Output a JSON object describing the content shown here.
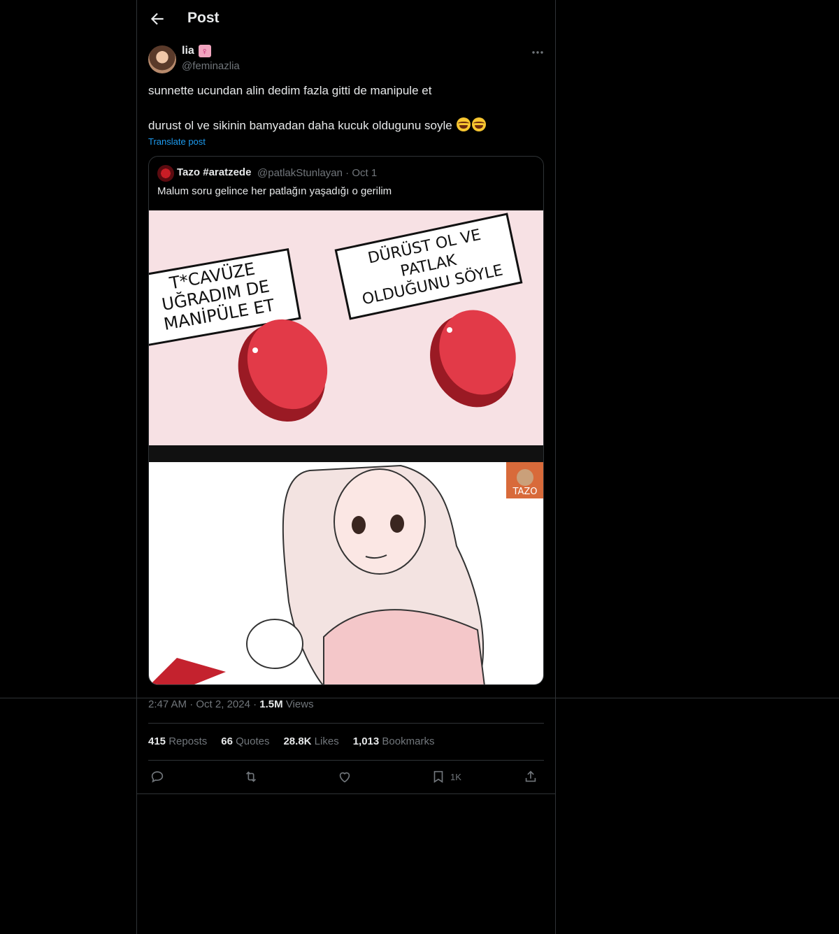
{
  "header": {
    "title": "Post"
  },
  "post": {
    "display_name": "lia",
    "name_emoji": "♀",
    "handle": "@feminazlia",
    "line1": "sunnette ucundan alin dedim fazla gitti de manipule et",
    "line2": "durust ol ve sikinin bamyadan daha kucuk oldugunu soyle",
    "translate_label": "Translate post",
    "time": "2:47 AM",
    "date": "Oct 2, 2024",
    "views_count": "1.5M",
    "views_label": "Views"
  },
  "quote": {
    "display_name": "Tazo #aratzede",
    "handle": "@patlakStunlayan",
    "date": "Oct 1",
    "text": "Malum soru gelince her patlağın yaşadığı o gerilim",
    "meme": {
      "left_card": [
        "T*CAVÜZE",
        "UĞRADIM DE",
        "MANİPÜLE ET"
      ],
      "right_card": [
        "DÜRÜST OL VE",
        "PATLAK",
        "OLDUĞUNU SÖYLE"
      ],
      "watermark": "TAZO"
    }
  },
  "stats": {
    "reposts_count": "415",
    "reposts_label": "Reposts",
    "quotes_count": "66",
    "quotes_label": "Quotes",
    "likes_count": "28.8K",
    "likes_label": "Likes",
    "bookmarks_count": "1,013",
    "bookmarks_label": "Bookmarks"
  },
  "actions": {
    "bookmark_count": "1K"
  },
  "icons": [
    "back-arrow-icon",
    "more-icon",
    "reply-icon",
    "repost-icon",
    "like-icon",
    "bookmark-icon",
    "share-icon"
  ],
  "colors": {
    "link": "#1d9bf0",
    "muted": "#71767b",
    "border": "#2f3336"
  }
}
